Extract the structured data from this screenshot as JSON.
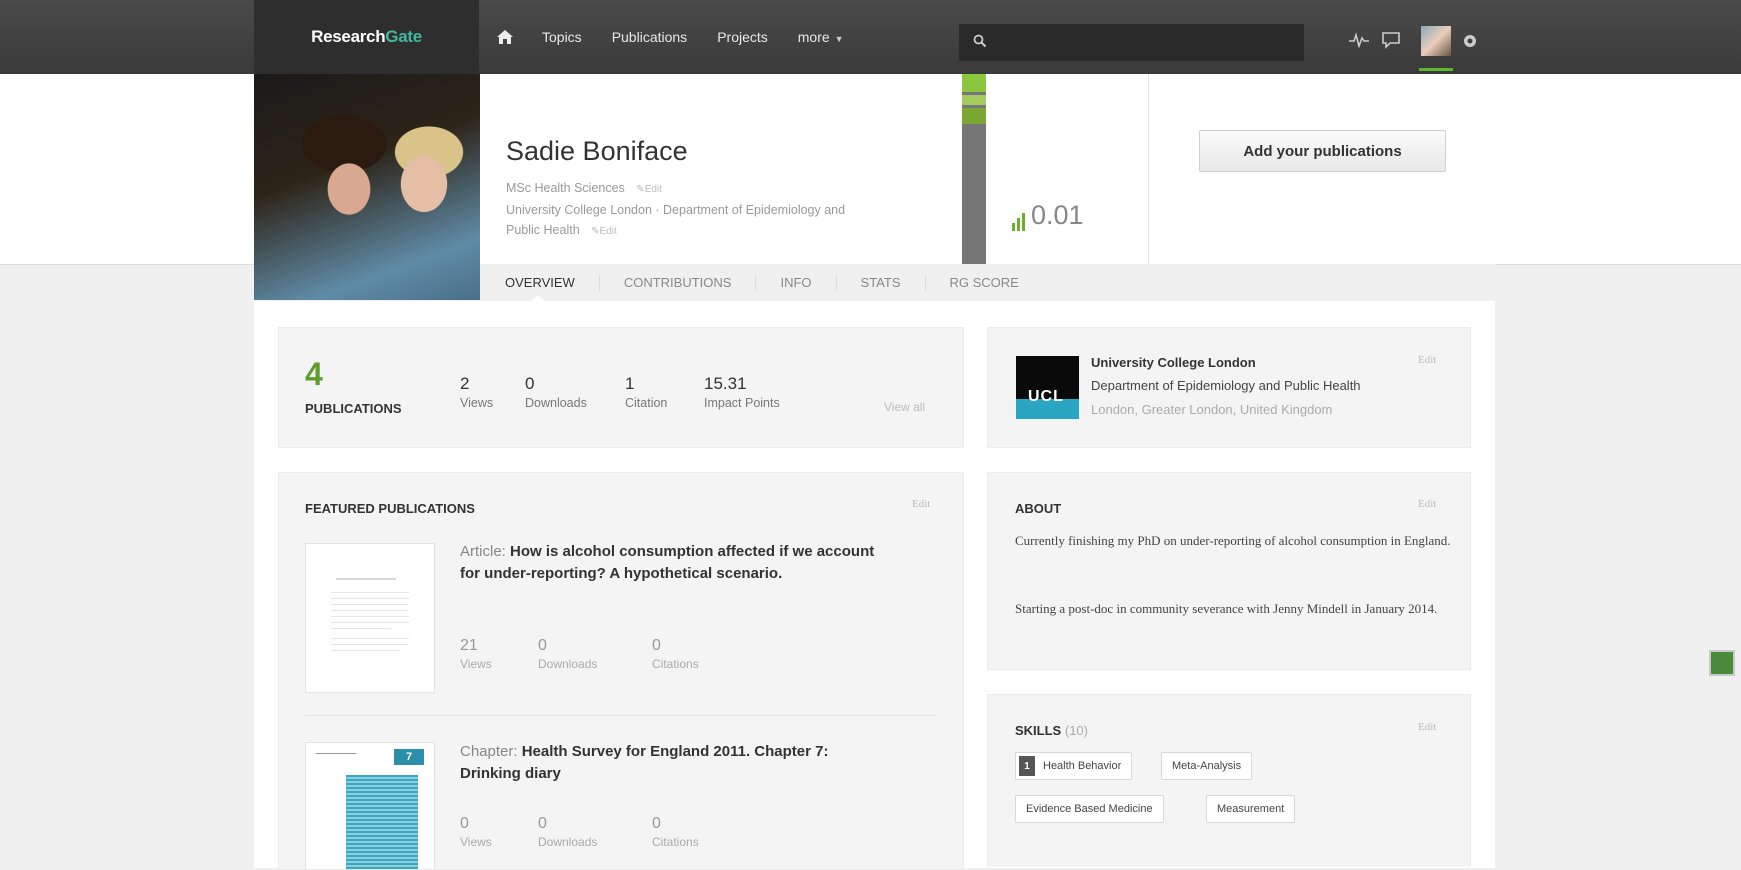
{
  "topbar": {
    "logo_part1": "Research",
    "logo_part2": "Gate",
    "nav": [
      "Topics",
      "Publications",
      "Projects",
      "more"
    ],
    "search_placeholder": ""
  },
  "profile": {
    "name": "Sadie Boniface",
    "degree": "MSc Health Sciences",
    "affiliation_line1": "University College London · Department of Epidemiology and",
    "affiliation_line2": "Public Health",
    "edit_label": "Edit",
    "rg_score": "0.01",
    "add_publications": "Add your publications"
  },
  "tabs": [
    "OVERVIEW",
    "CONTRIBUTIONS",
    "INFO",
    "STATS",
    "RG SCORE"
  ],
  "summary": {
    "publications_count": "4",
    "publications_label": "PUBLICATIONS",
    "views": {
      "n": "2",
      "l": "Views"
    },
    "downloads": {
      "n": "0",
      "l": "Downloads"
    },
    "citation": {
      "n": "1",
      "l": "Citation"
    },
    "impact": {
      "n": "15.31",
      "l": "Impact Points"
    },
    "view_all": "View all"
  },
  "featured": {
    "title": "FEATURED PUBLICATIONS",
    "edit": "Edit",
    "items": [
      {
        "type": "Article:",
        "title": "How is alcohol consumption affected if we account for under-reporting? A hypothetical scenario.",
        "views": "21",
        "downloads": "0",
        "citations": "0"
      },
      {
        "type": "Chapter:",
        "title": "Health Survey for England 2011. Chapter 7: Drinking diary",
        "views": "0",
        "downloads": "0",
        "citations": "0",
        "thumb_badge": "7"
      }
    ],
    "labels": {
      "views": "Views",
      "downloads": "Downloads",
      "citations": "Citations"
    }
  },
  "institution": {
    "name": "University College London",
    "department": "Department of Epidemiology and Public Health",
    "location": "London, Greater London, United Kingdom",
    "logo_text": "UCL",
    "edit": "Edit"
  },
  "about": {
    "title": "ABOUT",
    "edit": "Edit",
    "p1": "Currently finishing my PhD on under-reporting of alcohol consumption in England.",
    "p2": "Starting a post-doc in community severance with Jenny Mindell in January 2014."
  },
  "skills": {
    "title": "SKILLS",
    "count": "(10)",
    "edit": "Edit",
    "badge": "1",
    "items": [
      "Health Behavior",
      "Meta-Analysis",
      "Evidence Based Medicine",
      "Measurement"
    ]
  },
  "colors": {
    "brand_green": "#5c9e2e",
    "logo_accent": "#40ba9b",
    "ucl_blue": "#2aa5c2"
  }
}
